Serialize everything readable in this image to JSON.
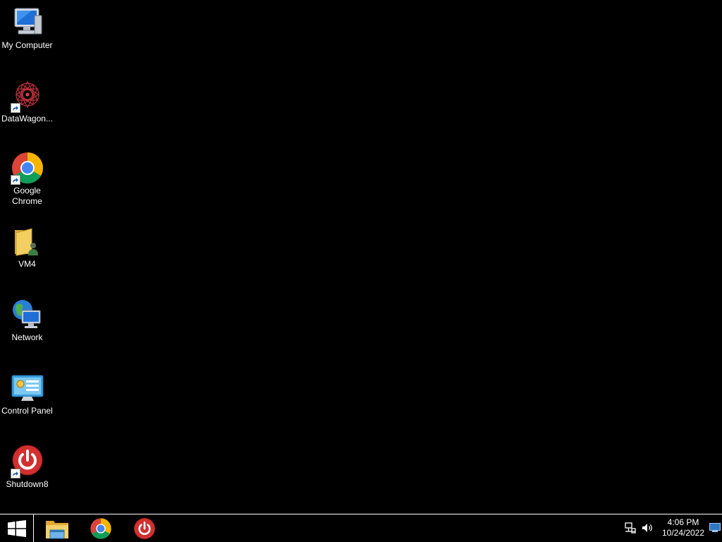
{
  "desktop": {
    "icons": [
      {
        "label": "My Computer",
        "icon": "my-computer-icon"
      },
      {
        "label": "DataWagon...",
        "icon": "datawagon-icon",
        "shortcut": true
      },
      {
        "label": "Google Chrome",
        "icon": "chrome-icon",
        "shortcut": true
      },
      {
        "label": "VM4",
        "icon": "folder-icon"
      },
      {
        "label": "Network",
        "icon": "network-icon"
      },
      {
        "label": "Control Panel",
        "icon": "control-panel-icon"
      },
      {
        "label": "Shutdown8",
        "icon": "power-icon",
        "shortcut": true
      }
    ]
  },
  "taskbar": {
    "start_icon": "windows-logo-icon",
    "pinned": [
      {
        "name": "File Explorer",
        "icon": "file-explorer-icon"
      },
      {
        "name": "Google Chrome",
        "icon": "chrome-icon"
      },
      {
        "name": "Shutdown8",
        "icon": "power-icon"
      }
    ],
    "tray": {
      "network_icon": "network-tray-icon",
      "volume_icon": "volume-icon",
      "time": "4:06 PM",
      "date": "10/24/2022",
      "show_desktop_icon": "show-desktop-icon"
    }
  },
  "colors": {
    "background": "#000000",
    "taskbar": "#000000",
    "text": "#ffffff",
    "chrome_red": "#DB4437",
    "chrome_yellow": "#F4B400",
    "chrome_green": "#0F9D58",
    "chrome_blue": "#4285F4",
    "power_red": "#D32F2F"
  }
}
